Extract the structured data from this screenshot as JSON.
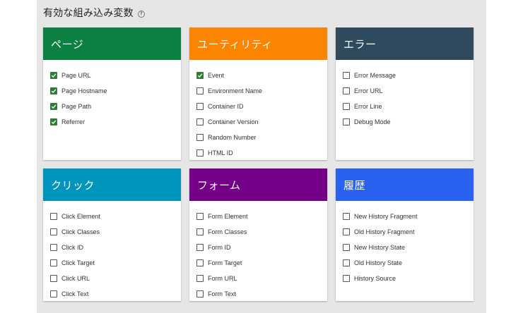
{
  "title": "有効な組み込み変数",
  "help_icon": "?",
  "cards": [
    {
      "title": "ページ",
      "color": "#0b8043",
      "items": [
        {
          "label": "Page URL",
          "checked": true
        },
        {
          "label": "Page Hostname",
          "checked": true
        },
        {
          "label": "Page Path",
          "checked": true
        },
        {
          "label": "Referrer",
          "checked": true
        }
      ]
    },
    {
      "title": "ユーティリティ",
      "color": "#fb8500",
      "items": [
        {
          "label": "Event",
          "checked": true
        },
        {
          "label": "Environment Name",
          "checked": false
        },
        {
          "label": "Container ID",
          "checked": false
        },
        {
          "label": "Container Version",
          "checked": false
        },
        {
          "label": "Random Number",
          "checked": false
        },
        {
          "label": "HTML ID",
          "checked": false
        }
      ]
    },
    {
      "title": "エラー",
      "color": "#2e4a5c",
      "items": [
        {
          "label": "Error Message",
          "checked": false
        },
        {
          "label": "Error URL",
          "checked": false
        },
        {
          "label": "Error Line",
          "checked": false
        },
        {
          "label": "Debug Mode",
          "checked": false
        }
      ]
    },
    {
      "title": "クリック",
      "color": "#0095bc",
      "items": [
        {
          "label": "Click Element",
          "checked": false
        },
        {
          "label": "Click Classes",
          "checked": false
        },
        {
          "label": "Click ID",
          "checked": false
        },
        {
          "label": "Click Target",
          "checked": false
        },
        {
          "label": "Click URL",
          "checked": false
        },
        {
          "label": "Click Text",
          "checked": false
        }
      ]
    },
    {
      "title": "フォーム",
      "color": "#730087",
      "items": [
        {
          "label": "Form Element",
          "checked": false
        },
        {
          "label": "Form Classes",
          "checked": false
        },
        {
          "label": "Form ID",
          "checked": false
        },
        {
          "label": "Form Target",
          "checked": false
        },
        {
          "label": "Form URL",
          "checked": false
        },
        {
          "label": "Form Text",
          "checked": false
        }
      ]
    },
    {
      "title": "履歴",
      "color": "#2962ef",
      "items": [
        {
          "label": "New History Fragment",
          "checked": false
        },
        {
          "label": "Old History Fragment",
          "checked": false
        },
        {
          "label": "New History State",
          "checked": false
        },
        {
          "label": "Old History State",
          "checked": false
        },
        {
          "label": "History Source",
          "checked": false
        }
      ]
    }
  ]
}
